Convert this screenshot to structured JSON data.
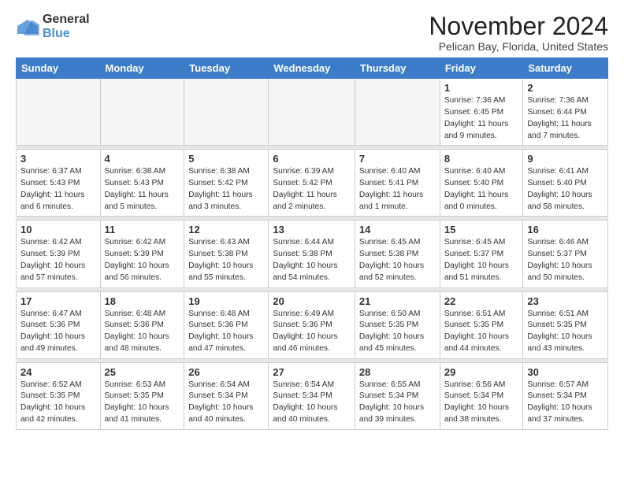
{
  "header": {
    "logo_general": "General",
    "logo_blue": "Blue",
    "month_title": "November 2024",
    "location": "Pelican Bay, Florida, United States"
  },
  "days_of_week": [
    "Sunday",
    "Monday",
    "Tuesday",
    "Wednesday",
    "Thursday",
    "Friday",
    "Saturday"
  ],
  "weeks": [
    {
      "days": [
        {
          "num": "",
          "info": ""
        },
        {
          "num": "",
          "info": ""
        },
        {
          "num": "",
          "info": ""
        },
        {
          "num": "",
          "info": ""
        },
        {
          "num": "",
          "info": ""
        },
        {
          "num": "1",
          "info": "Sunrise: 7:36 AM\nSunset: 6:45 PM\nDaylight: 11 hours\nand 9 minutes."
        },
        {
          "num": "2",
          "info": "Sunrise: 7:36 AM\nSunset: 6:44 PM\nDaylight: 11 hours\nand 7 minutes."
        }
      ]
    },
    {
      "days": [
        {
          "num": "3",
          "info": "Sunrise: 6:37 AM\nSunset: 5:43 PM\nDaylight: 11 hours\nand 6 minutes."
        },
        {
          "num": "4",
          "info": "Sunrise: 6:38 AM\nSunset: 5:43 PM\nDaylight: 11 hours\nand 5 minutes."
        },
        {
          "num": "5",
          "info": "Sunrise: 6:38 AM\nSunset: 5:42 PM\nDaylight: 11 hours\nand 3 minutes."
        },
        {
          "num": "6",
          "info": "Sunrise: 6:39 AM\nSunset: 5:42 PM\nDaylight: 11 hours\nand 2 minutes."
        },
        {
          "num": "7",
          "info": "Sunrise: 6:40 AM\nSunset: 5:41 PM\nDaylight: 11 hours\nand 1 minute."
        },
        {
          "num": "8",
          "info": "Sunrise: 6:40 AM\nSunset: 5:40 PM\nDaylight: 11 hours\nand 0 minutes."
        },
        {
          "num": "9",
          "info": "Sunrise: 6:41 AM\nSunset: 5:40 PM\nDaylight: 10 hours\nand 58 minutes."
        }
      ]
    },
    {
      "days": [
        {
          "num": "10",
          "info": "Sunrise: 6:42 AM\nSunset: 5:39 PM\nDaylight: 10 hours\nand 57 minutes."
        },
        {
          "num": "11",
          "info": "Sunrise: 6:42 AM\nSunset: 5:39 PM\nDaylight: 10 hours\nand 56 minutes."
        },
        {
          "num": "12",
          "info": "Sunrise: 6:43 AM\nSunset: 5:38 PM\nDaylight: 10 hours\nand 55 minutes."
        },
        {
          "num": "13",
          "info": "Sunrise: 6:44 AM\nSunset: 5:38 PM\nDaylight: 10 hours\nand 54 minutes."
        },
        {
          "num": "14",
          "info": "Sunrise: 6:45 AM\nSunset: 5:38 PM\nDaylight: 10 hours\nand 52 minutes."
        },
        {
          "num": "15",
          "info": "Sunrise: 6:45 AM\nSunset: 5:37 PM\nDaylight: 10 hours\nand 51 minutes."
        },
        {
          "num": "16",
          "info": "Sunrise: 6:46 AM\nSunset: 5:37 PM\nDaylight: 10 hours\nand 50 minutes."
        }
      ]
    },
    {
      "days": [
        {
          "num": "17",
          "info": "Sunrise: 6:47 AM\nSunset: 5:36 PM\nDaylight: 10 hours\nand 49 minutes."
        },
        {
          "num": "18",
          "info": "Sunrise: 6:48 AM\nSunset: 5:36 PM\nDaylight: 10 hours\nand 48 minutes."
        },
        {
          "num": "19",
          "info": "Sunrise: 6:48 AM\nSunset: 5:36 PM\nDaylight: 10 hours\nand 47 minutes."
        },
        {
          "num": "20",
          "info": "Sunrise: 6:49 AM\nSunset: 5:36 PM\nDaylight: 10 hours\nand 46 minutes."
        },
        {
          "num": "21",
          "info": "Sunrise: 6:50 AM\nSunset: 5:35 PM\nDaylight: 10 hours\nand 45 minutes."
        },
        {
          "num": "22",
          "info": "Sunrise: 6:51 AM\nSunset: 5:35 PM\nDaylight: 10 hours\nand 44 minutes."
        },
        {
          "num": "23",
          "info": "Sunrise: 6:51 AM\nSunset: 5:35 PM\nDaylight: 10 hours\nand 43 minutes."
        }
      ]
    },
    {
      "days": [
        {
          "num": "24",
          "info": "Sunrise: 6:52 AM\nSunset: 5:35 PM\nDaylight: 10 hours\nand 42 minutes."
        },
        {
          "num": "25",
          "info": "Sunrise: 6:53 AM\nSunset: 5:35 PM\nDaylight: 10 hours\nand 41 minutes."
        },
        {
          "num": "26",
          "info": "Sunrise: 6:54 AM\nSunset: 5:34 PM\nDaylight: 10 hours\nand 40 minutes."
        },
        {
          "num": "27",
          "info": "Sunrise: 6:54 AM\nSunset: 5:34 PM\nDaylight: 10 hours\nand 40 minutes."
        },
        {
          "num": "28",
          "info": "Sunrise: 6:55 AM\nSunset: 5:34 PM\nDaylight: 10 hours\nand 39 minutes."
        },
        {
          "num": "29",
          "info": "Sunrise: 6:56 AM\nSunset: 5:34 PM\nDaylight: 10 hours\nand 38 minutes."
        },
        {
          "num": "30",
          "info": "Sunrise: 6:57 AM\nSunset: 5:34 PM\nDaylight: 10 hours\nand 37 minutes."
        }
      ]
    }
  ]
}
